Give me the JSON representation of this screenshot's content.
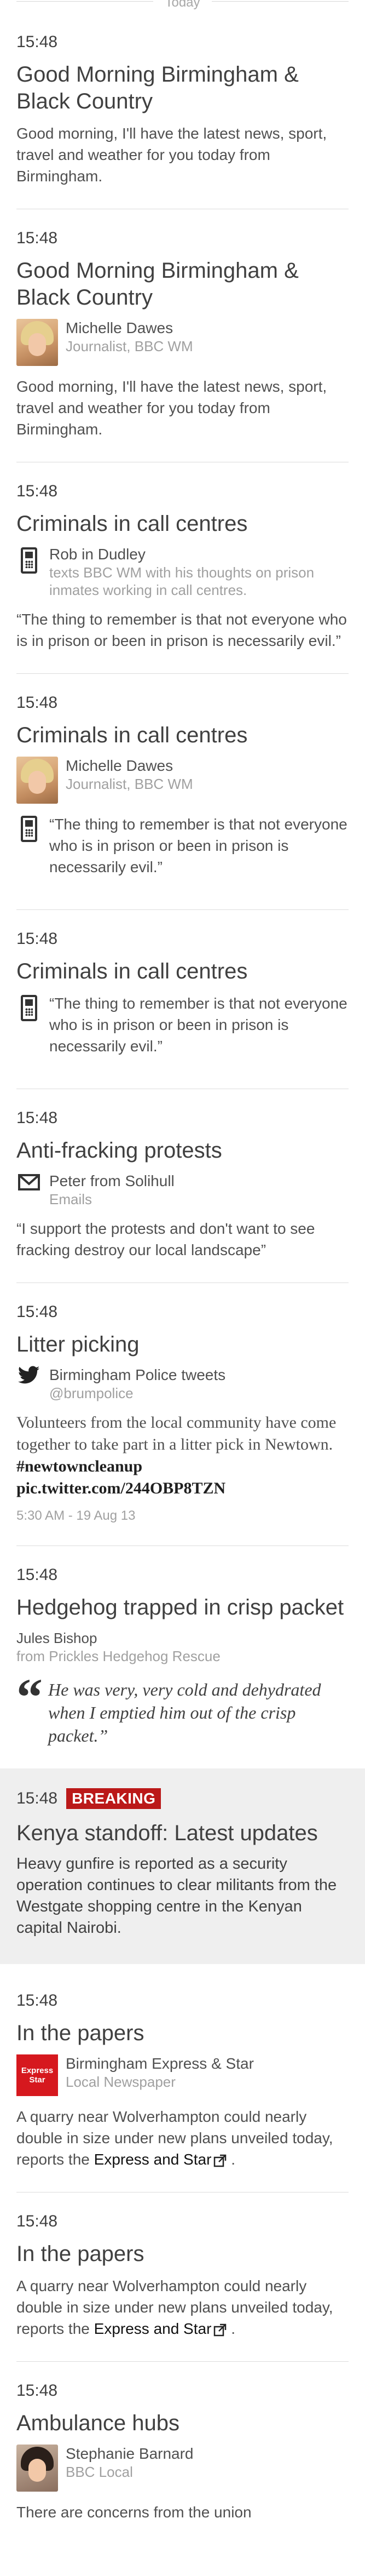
{
  "divider_label": "Today",
  "entries": [
    {
      "time": "15:48",
      "headline": "Good Morning Birmingham & Black Country",
      "body": "Good morning, I'll have the latest news, sport, travel and weather for you today from Birmingham."
    },
    {
      "time": "15:48",
      "headline": "Good Morning Birmingham & Black Country",
      "author": "Michelle Dawes",
      "role": "Journalist, BBC WM",
      "body": "Good morning, I'll have the latest news, sport, travel and weather for you today from Birmingham."
    },
    {
      "time": "15:48",
      "headline": "Criminals in call centres",
      "author": "Rob in Dudley",
      "role": "texts BBC WM with his thoughts on prison inmates working in call centres.",
      "quote": "“The thing to remember is that not everyone who is in prison or been in prison is necessarily evil.”"
    },
    {
      "time": "15:48",
      "headline": "Criminals in call centres",
      "author": "Michelle Dawes",
      "role": "Journalist, BBC WM",
      "quote": "“The thing to remember is that not everyone who is in prison or been in prison is necessarily evil.”"
    },
    {
      "time": "15:48",
      "headline": "Criminals in call centres",
      "quote": "“The thing to remember is that not everyone who is in prison or been in prison is necessarily evil.”"
    },
    {
      "time": "15:48",
      "headline": "Anti-fracking protests",
      "author": "Peter from Solihull",
      "role": "Emails",
      "quote": "“I support the protests and don't want to see fracking destroy our local landscape”"
    },
    {
      "time": "15:48",
      "headline": "Litter picking",
      "author": "Birmingham Police tweets",
      "role": "@brumpolice",
      "tweet_text": "Volunteers from the local community have come together to take part in a litter pick in Newtown.",
      "tweet_tag": "#newtowncleanup",
      "tweet_link": "pic.twitter.com/244OBP8TZN",
      "tweet_meta": "5:30 AM - 19 Aug 13"
    },
    {
      "time": "15:48",
      "headline": "Hedgehog trapped in crisp packet",
      "author": "Jules Bishop",
      "role": "from Prickles Hedgehog Rescue",
      "pull_quote": "He was very, very cold and dehydrated when I emptied him out of the crisp packet.”"
    },
    {
      "time": "15:48",
      "badge": "BREAKING",
      "headline": "Kenya standoff: Latest updates",
      "body": "Heavy gunfire is reported as a security operation continues to clear militants from the Westgate shopping centre in the Kenyan capital Nairobi."
    },
    {
      "time": "15:48",
      "headline": "In the papers",
      "author": "Birmingham Express & Star",
      "role": "Local Newspaper",
      "logo_line1": "Express",
      "logo_line2": "Star",
      "body_pre": "A quarry near Wolverhampton could nearly double in size under new plans unveiled today, reports the ",
      "link": "Express and Star",
      "body_post": " ."
    },
    {
      "time": "15:48",
      "headline": "In the papers",
      "body_pre": "A quarry near Wolverhampton could nearly double in size under new plans unveiled today, reports the ",
      "link": "Express and Star",
      "body_post": " ."
    },
    {
      "time": "15:48",
      "headline": "Ambulance hubs",
      "author": "Stephanie Barnard",
      "role": "BBC Local",
      "body": "There are concerns from the union"
    }
  ]
}
